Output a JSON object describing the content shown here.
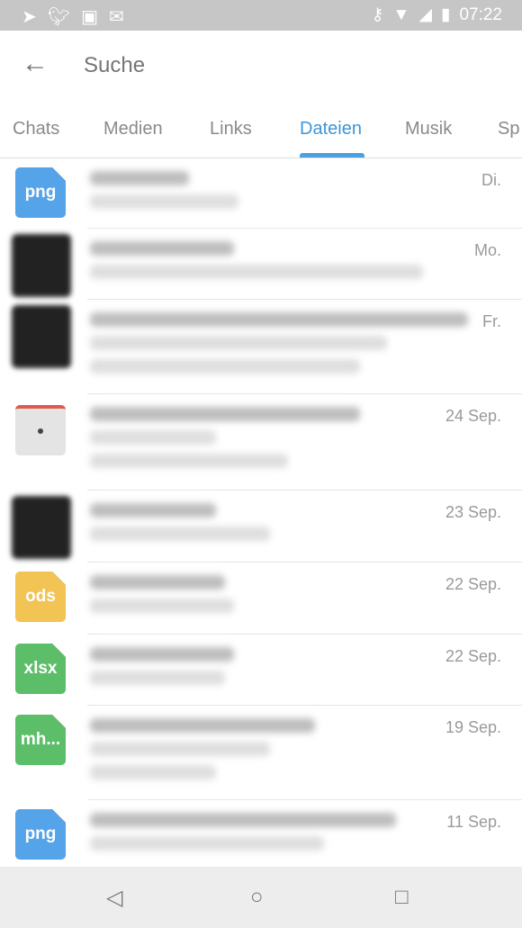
{
  "status_bar": {
    "time": "07:22",
    "left_icons": [
      "telegram-icon",
      "twitter-icon",
      "image-icon",
      "mail-icon"
    ],
    "right_icons": [
      "vpn-key-icon",
      "wifi-icon",
      "signal-icon",
      "battery-charging-icon"
    ]
  },
  "header": {
    "back_icon": "arrow-left-icon",
    "search_placeholder": "Suche"
  },
  "tabs": [
    {
      "label": "Chats"
    },
    {
      "label": "Medien"
    },
    {
      "label": "Links"
    },
    {
      "label": "Dateien",
      "active": true
    },
    {
      "label": "Musik"
    },
    {
      "label": "Sp"
    }
  ],
  "accent_color": "#3d95d8",
  "files": [
    {
      "icon": "png",
      "color": "#55a3e8",
      "date": "Di."
    },
    {
      "icon": "thumbnail",
      "date": "Mo."
    },
    {
      "icon": "thumbnail",
      "date": "Fr."
    },
    {
      "icon": "document-thumbnail",
      "date": "24 Sep."
    },
    {
      "icon": "thumbnail",
      "date": "23 Sep."
    },
    {
      "icon": "ods",
      "color": "#f1c453",
      "date": "22 Sep."
    },
    {
      "icon": "xlsx",
      "color": "#5dbe6a",
      "date": "22 Sep."
    },
    {
      "icon": "mh...",
      "color": "#5dbe6a",
      "date": "19 Sep."
    },
    {
      "icon": "png",
      "color": "#55a3e8",
      "date": "11 Sep."
    }
  ],
  "nav_bar": {
    "icons": [
      "back-triangle-icon",
      "home-circle-icon",
      "recents-square-icon"
    ]
  }
}
